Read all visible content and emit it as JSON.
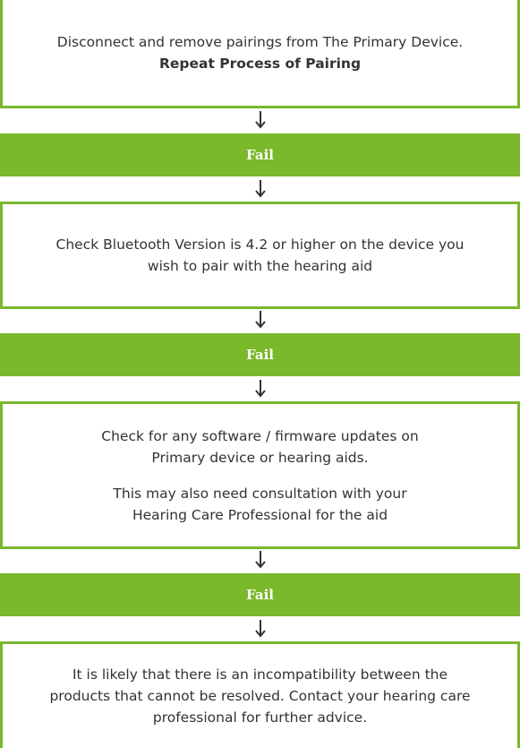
{
  "steps": [
    {
      "line1": "Disconnect and remove pairings from The Primary Device.",
      "line2": "Repeat Process of Pairing"
    },
    {
      "line1": "Check Bluetooth Version is 4.2 or higher on the device you",
      "line2": "wish to pair with the hearing aid"
    },
    {
      "para1_line1": "Check for any software / firmware updates on",
      "para1_line2": "Primary device or hearing aids.",
      "para2_line1": "This may also need consultation with your",
      "para2_line2": "Hearing Care Professional for the aid"
    },
    {
      "line1": "It is likely that there is an incompatibility between the",
      "line2": "products that cannot be resolved. Contact your hearing care",
      "line3": "professional for further advice."
    }
  ],
  "fail_labels": [
    "Fail",
    "Fail",
    "Fail"
  ],
  "colors": {
    "accent_green": "#7ab82c",
    "text": "#333333",
    "fail_text": "#ffffff"
  }
}
